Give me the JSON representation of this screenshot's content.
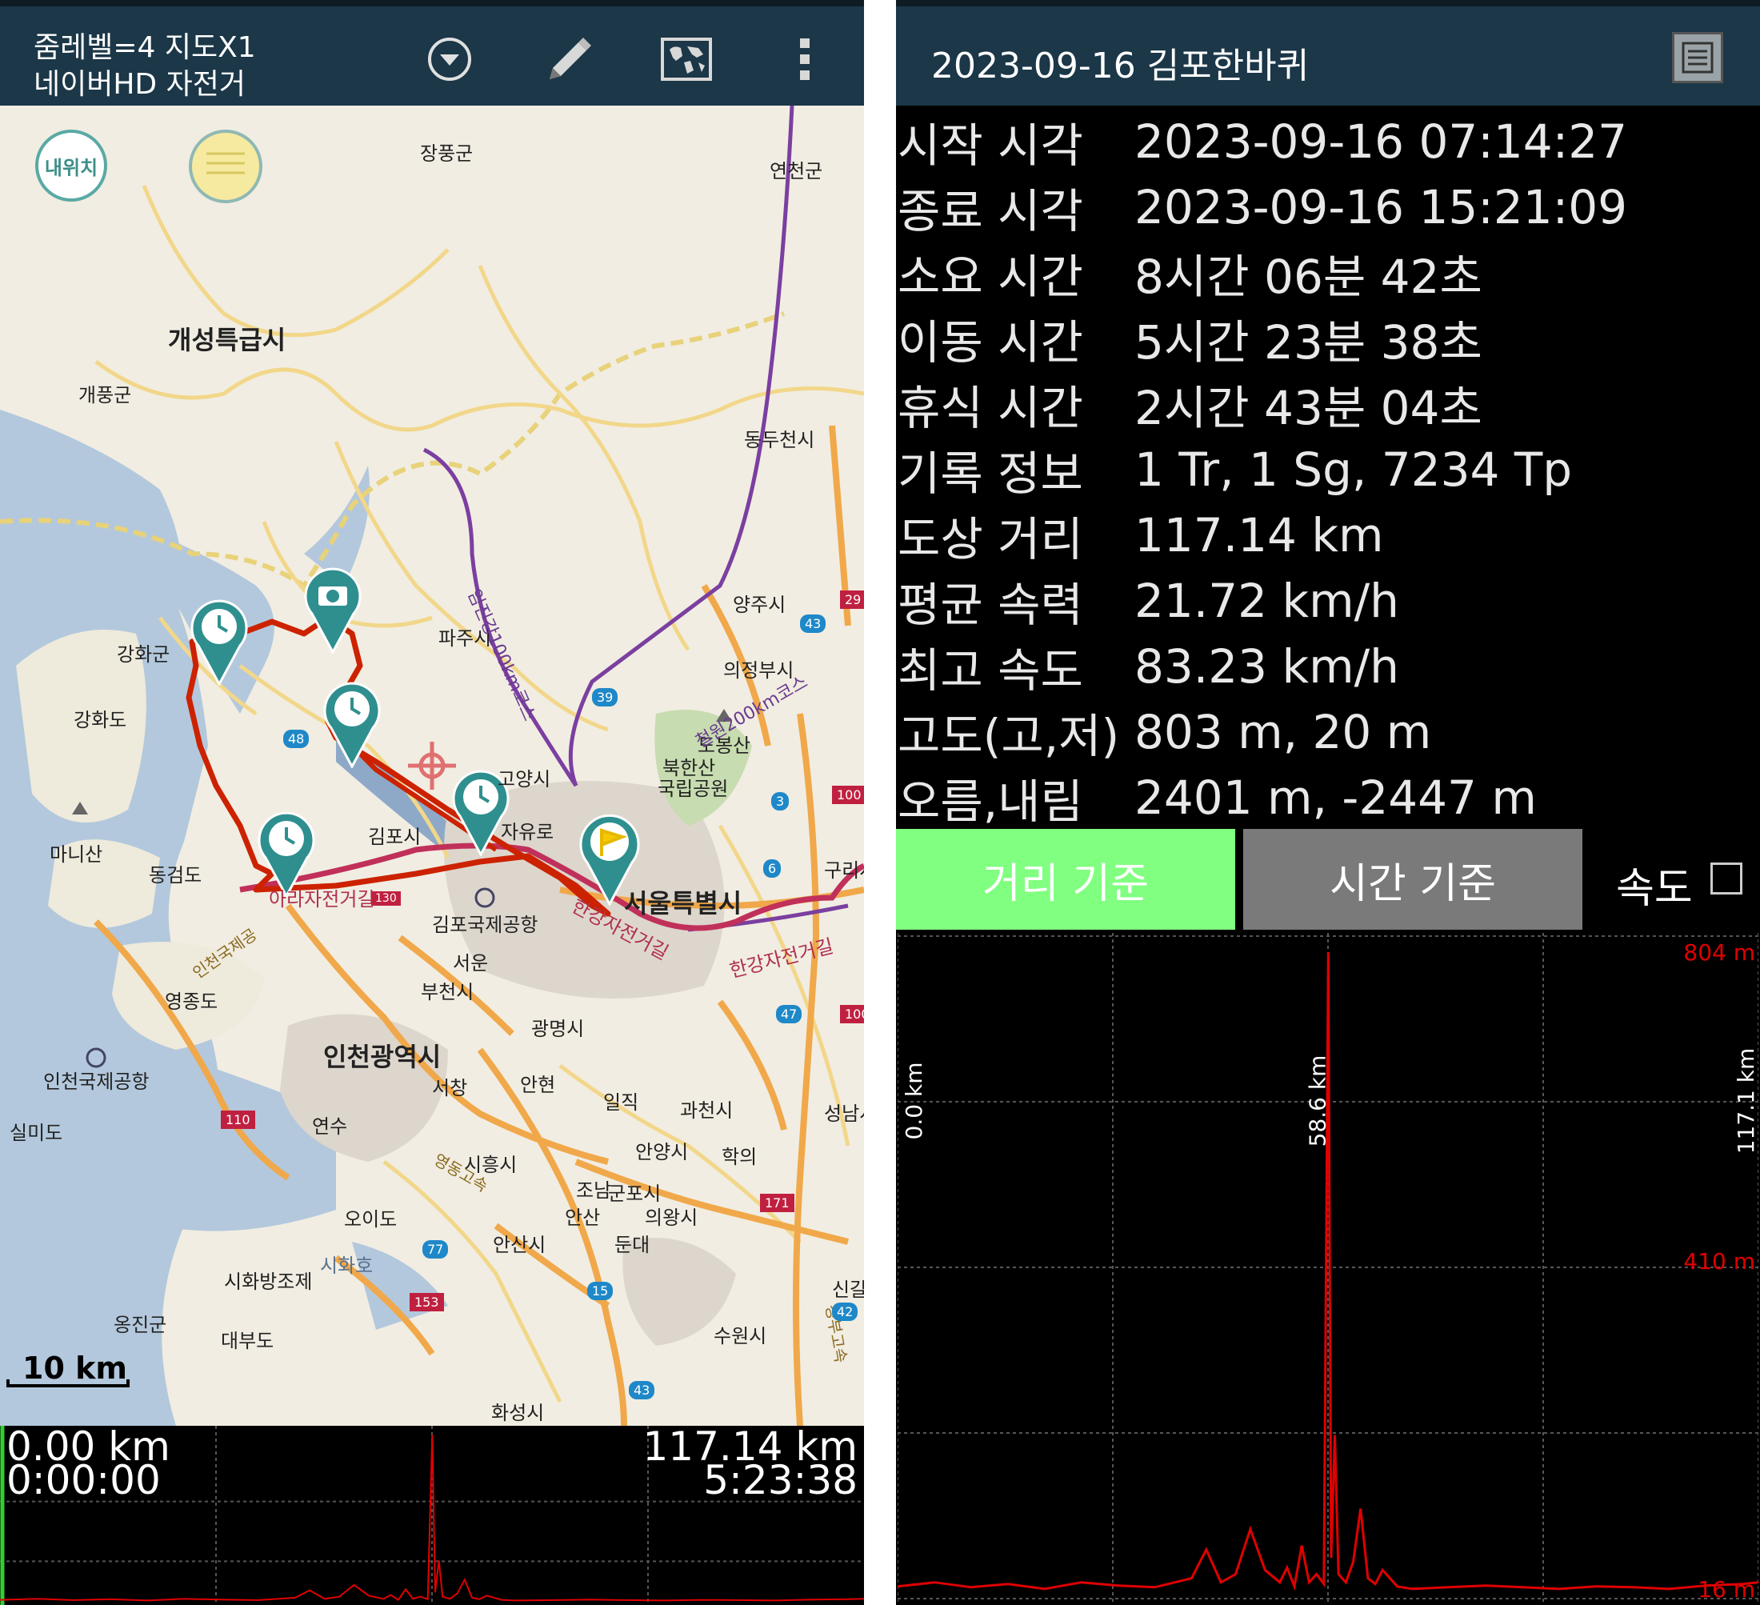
{
  "left": {
    "header": {
      "line1": "줌레벨=4 지도X1",
      "line2": "네이버HD 자전거"
    },
    "icons": [
      "dropdown-circle-icon",
      "pencil-icon",
      "world-map-icon",
      "more-vert-icon"
    ],
    "map": {
      "my_location_label": "내위치",
      "scale": "10 km",
      "labels": {
        "jangpung": "장풍군",
        "yeoncheon": "연천군",
        "gaeseong": "개성특급시",
        "gaepung": "개풍군",
        "dongducheon": "동두천시",
        "yangju": "양주시",
        "paju": "파주시",
        "ganghwa_gun": "강화군",
        "ganghwa_do": "강화도",
        "uijeongbu": "의정부시",
        "dobongsan": "도봉산",
        "bukhansan": "북한산",
        "national_park": "국립공원",
        "goyang": "고양시",
        "jayuro": "자유로",
        "gimpo": "김포시",
        "manisan": "마니산",
        "donggeomdo": "동검도",
        "guri": "구리시",
        "seoul": "서울특별시",
        "gimpo_airport": "김포국제공항",
        "seoun": "서운",
        "yeongjongdo": "영종도",
        "bucheon": "부천시",
        "gwangmyeong": "광명시",
        "incheon": "인천광역시",
        "incheon_airport": "인천국제공항",
        "seochang": "서창",
        "anhyeon": "안현",
        "iljik": "일직",
        "gwacheon": "과천시",
        "seongnam": "성남시",
        "silmido": "실미도",
        "yeonsu": "연수",
        "anyang": "안양시",
        "hagui": "학의",
        "siheung": "시흥시",
        "jonam": "조남",
        "gunpo": "군포시",
        "uiwang": "의왕시",
        "oido": "오이도",
        "ansan_jc": "안산",
        "ansan": "안산시",
        "dundae": "둔대",
        "sihwaho": "시화호",
        "sihwa_dike": "시화방조제",
        "singal": "신갈",
        "ongjin": "옹진군",
        "daebudo": "대부도",
        "suwon": "수원시",
        "hwaseong": "화성시",
        "hangang_bike": "한강자전거길",
        "ara_bike": "아라자전거길",
        "imjin_course": "임진강100km코스",
        "cheorwon_course": "철원200km코스",
        "incheon_grand": "인천국제공",
        "yeongdong": "영동고속",
        "gyeongbu": "경부고속"
      },
      "route_shields": [
        "48",
        "39",
        "29",
        "43",
        "100",
        "3",
        "6",
        "47",
        "100",
        "110",
        "130",
        "77",
        "153",
        "15",
        "171",
        "42",
        "43"
      ]
    },
    "mini_profile": {
      "start_distance": "0.00 km",
      "start_time": "0:00:00",
      "end_distance": "117.14 km",
      "end_time": "5:23:38"
    }
  },
  "right": {
    "header": {
      "title": "2023-09-16 김포한바퀴"
    },
    "stats": [
      {
        "label": "시작 시각",
        "value": "2023-09-16 07:14:27"
      },
      {
        "label": "종료 시각",
        "value": "2023-09-16 15:21:09"
      },
      {
        "label": "소요 시간",
        "value": "8시간 06분 42초"
      },
      {
        "label": "이동 시간",
        "value": "5시간 23분 38초"
      },
      {
        "label": "휴식 시간",
        "value": "2시간 43분 04초"
      },
      {
        "label": "기록 정보",
        "value": "1 Tr, 1 Sg, 7234 Tp"
      },
      {
        "label": "도상 거리",
        "value": "117.14 km"
      },
      {
        "label": "평균 속력",
        "value": "21.72 km/h"
      },
      {
        "label": "최고 속도",
        "value": "83.23 km/h"
      },
      {
        "label": "고도(고,저)",
        "value": "803 m, 20 m"
      },
      {
        "label": "오름,내림",
        "value": "2401 m, -2447 m"
      }
    ],
    "tabs": {
      "distance": "거리 기준",
      "time": "시간 기준",
      "speed": "속도"
    },
    "colors": {
      "tab_active": "#80ff80",
      "tab_inactive": "#7a7a7a",
      "profile_line": "#e00000",
      "route": "#cc2200",
      "marker": "#2f8f8f"
    }
  },
  "chart_data": {
    "type": "line",
    "title": "",
    "xlabel": "",
    "ylabel": "",
    "x_tick_labels": [
      "0.0 km",
      "58.6 km",
      "117.1 km"
    ],
    "y_tick_labels": [
      "804 m",
      "410 m",
      "16 m"
    ],
    "xlim": [
      0,
      117.14
    ],
    "ylim": [
      16,
      804
    ],
    "series": [
      {
        "x": [
          0,
          5,
          10,
          15,
          20,
          25,
          30,
          35,
          40,
          42,
          44,
          46,
          48,
          50,
          52,
          53,
          54,
          55,
          56,
          57,
          58,
          58.6,
          59,
          59.5,
          60,
          61,
          62,
          63,
          64,
          65,
          66,
          68,
          70,
          75,
          80,
          85,
          90,
          95,
          100,
          105,
          110,
          115,
          117.14
        ],
        "y": [
          25,
          30,
          24,
          28,
          22,
          30,
          26,
          24,
          35,
          70,
          30,
          40,
          95,
          45,
          30,
          48,
          25,
          75,
          30,
          40,
          28,
          800,
          60,
          210,
          40,
          30,
          55,
          120,
          35,
          28,
          45,
          25,
          22,
          24,
          26,
          24,
          22,
          25,
          24,
          22,
          26,
          28,
          30
        ]
      }
    ]
  }
}
